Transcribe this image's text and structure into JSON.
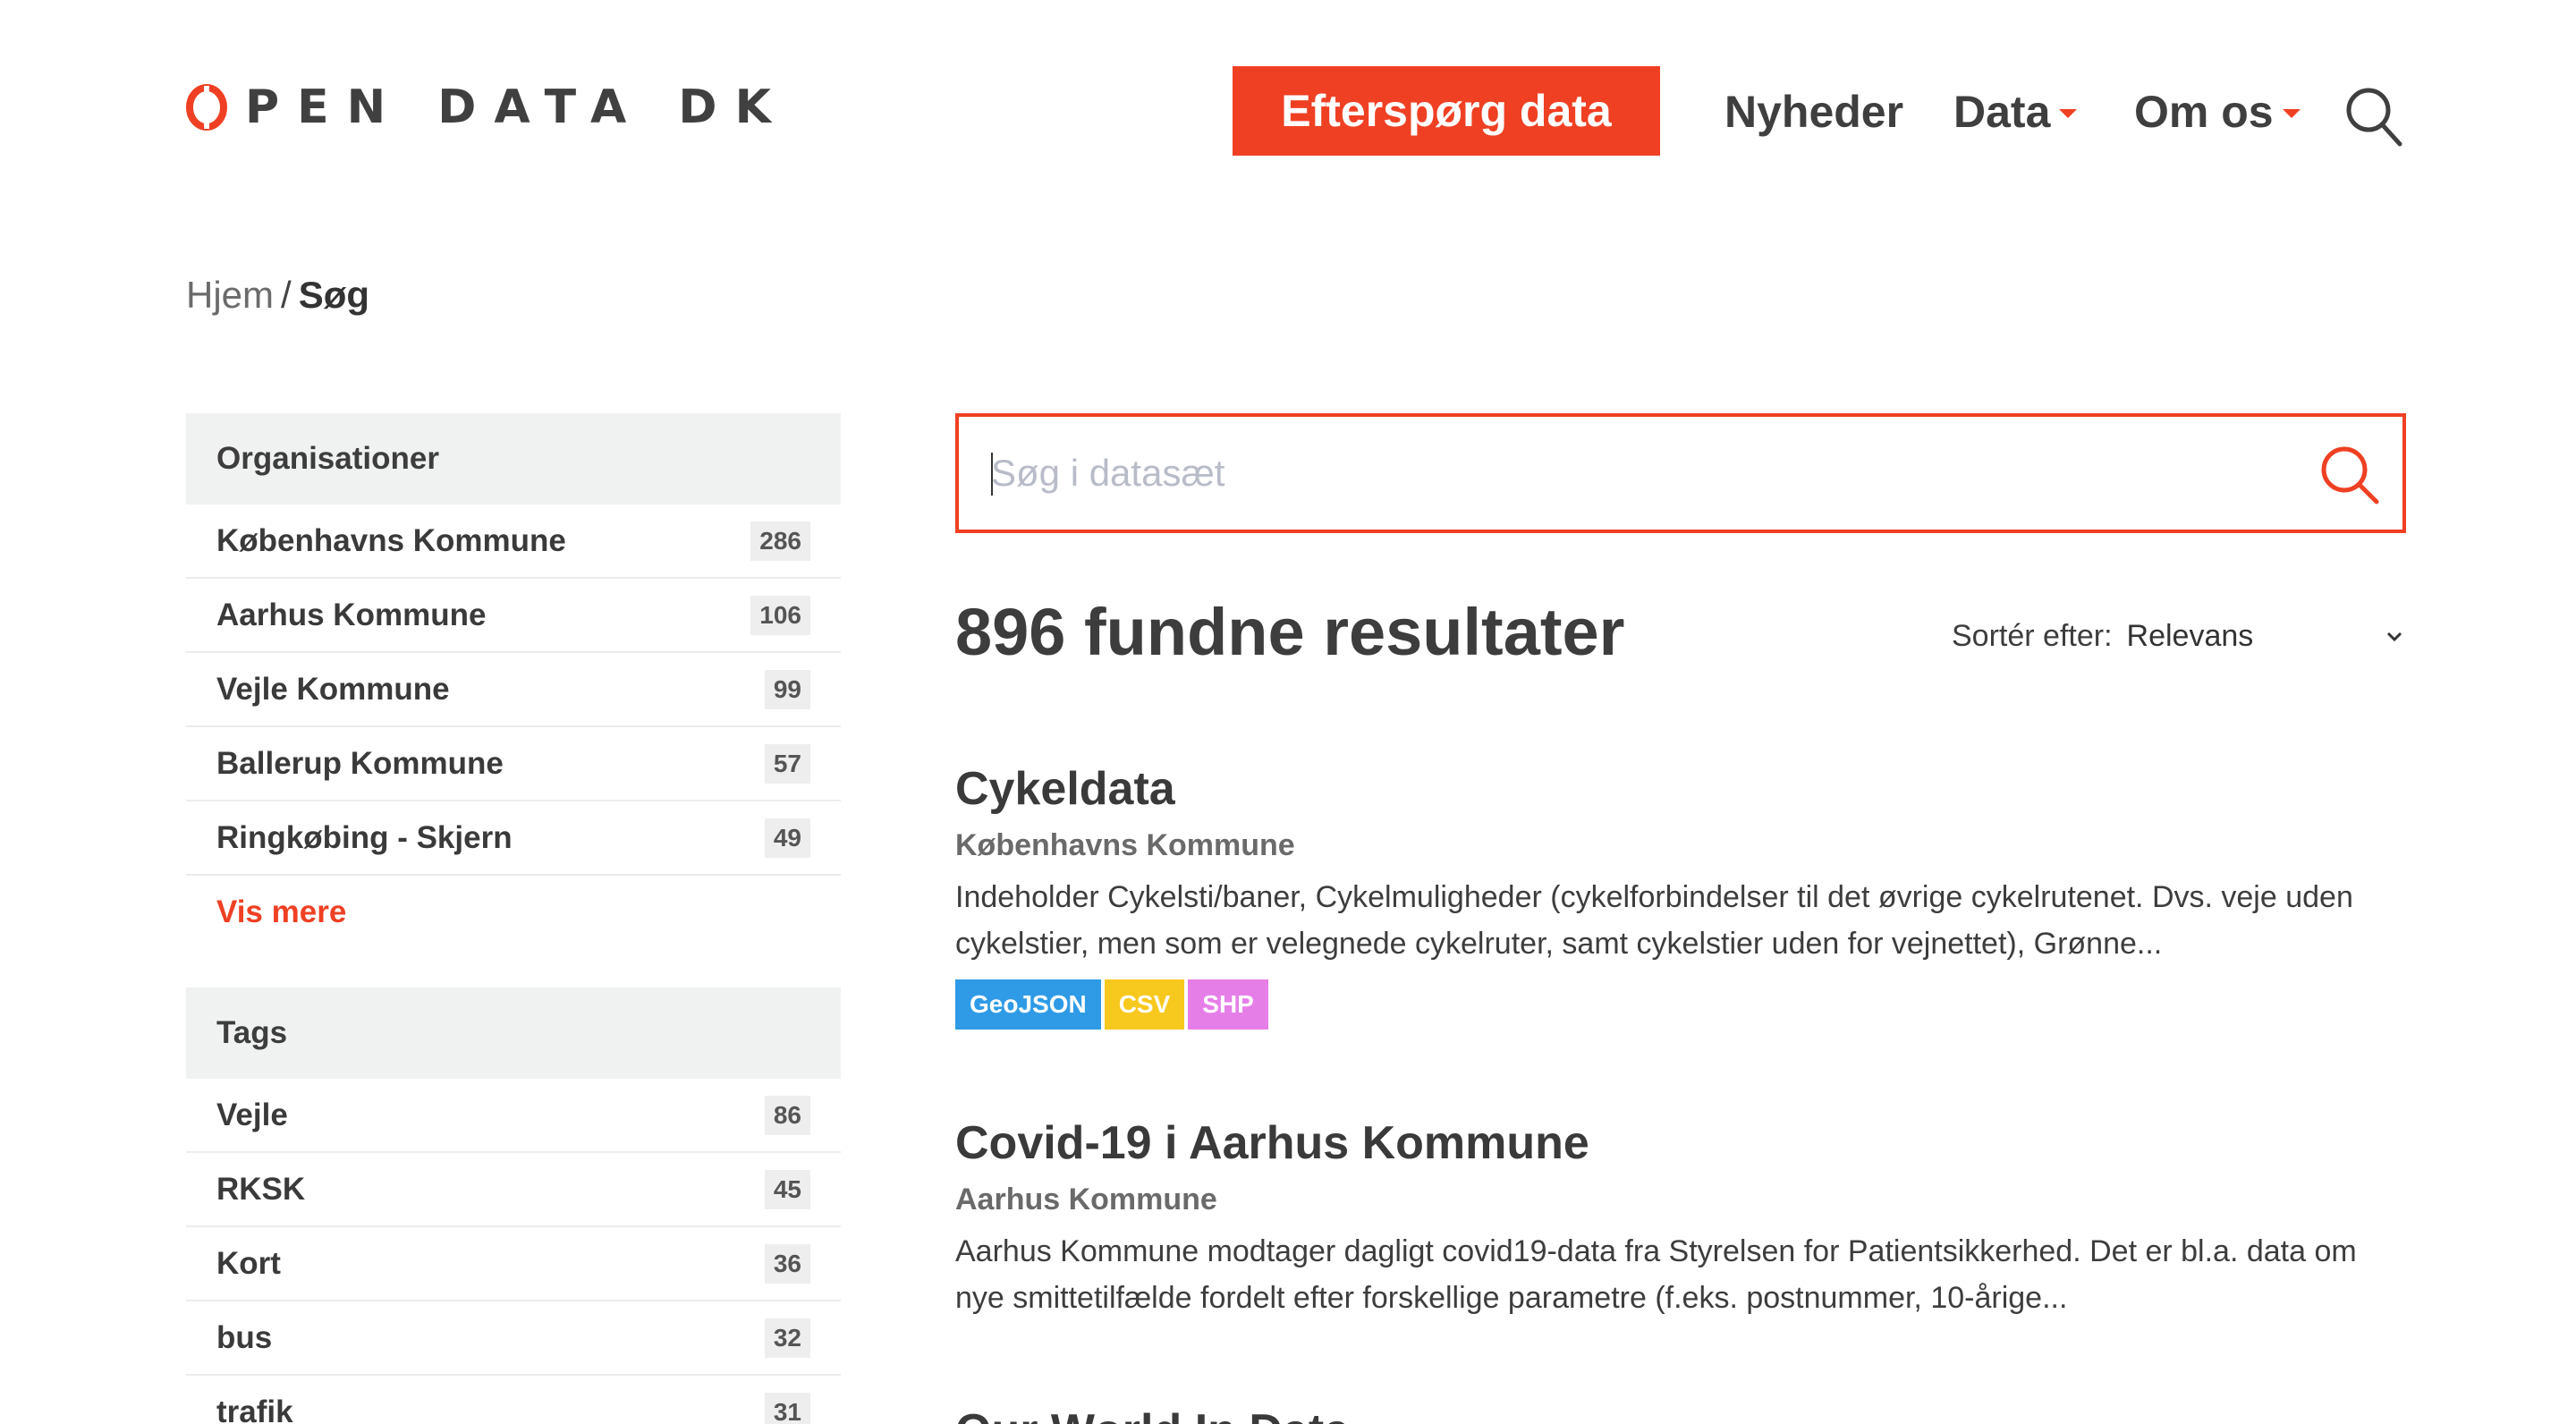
{
  "header": {
    "logo_text": "PEN DATA DK",
    "cta_label": "Efterspørg data",
    "nav": [
      {
        "label": "Nyheder",
        "dropdown": false
      },
      {
        "label": "Data",
        "dropdown": true
      },
      {
        "label": "Om os",
        "dropdown": true
      }
    ],
    "search_icon": "search-icon",
    "accent_color": "#ef4023"
  },
  "breadcrumb": {
    "home": "Hjem",
    "separator": "/",
    "current": "Søg"
  },
  "facets": {
    "organisations": {
      "title": "Organisationer",
      "items": [
        {
          "label": "Københavns Kommune",
          "count": "286"
        },
        {
          "label": "Aarhus Kommune",
          "count": "106"
        },
        {
          "label": "Vejle Kommune",
          "count": "99"
        },
        {
          "label": "Ballerup Kommune",
          "count": "57"
        },
        {
          "label": "Ringkøbing - Skjern",
          "count": "49"
        }
      ],
      "more_label": "Vis mere"
    },
    "tags": {
      "title": "Tags",
      "items": [
        {
          "label": "Vejle",
          "count": "86"
        },
        {
          "label": "RKSK",
          "count": "45"
        },
        {
          "label": "Kort",
          "count": "36"
        },
        {
          "label": "bus",
          "count": "32"
        },
        {
          "label": "trafik",
          "count": "31"
        }
      ]
    }
  },
  "search": {
    "placeholder": "Søg i datasæt",
    "value": ""
  },
  "results_header": {
    "count_text": "896 fundne resultater",
    "sort_label": "Sortér efter:",
    "sort_value": "Relevans"
  },
  "results": [
    {
      "title": "Cykeldata",
      "organisation": "Københavns Kommune",
      "description": "Indeholder Cykelsti/baner, Cykelmuligheder (cykelforbindelser til det øvrige cykelrutenet. Dvs. veje uden cykelstier, men som er velegnede cykelruter, samt cykelstier uden for vejnettet), Grønne...",
      "formats": [
        {
          "label": "GeoJSON",
          "color": "#2f9be6"
        },
        {
          "label": "CSV",
          "color": "#f7c81e"
        },
        {
          "label": "SHP",
          "color": "#e67ee8"
        }
      ]
    },
    {
      "title": "Covid-19 i Aarhus Kommune",
      "organisation": "Aarhus Kommune",
      "description": "Aarhus Kommune modtager dagligt covid19-data fra Styrelsen for Patientsikkerhed. Det er bl.a. data om nye smittetilfælde fordelt efter forskellige parametre (f.eks. postnummer, 10-årige...",
      "formats": []
    },
    {
      "title": "Our World In Data",
      "organisation": "",
      "description": "",
      "formats": []
    }
  ]
}
